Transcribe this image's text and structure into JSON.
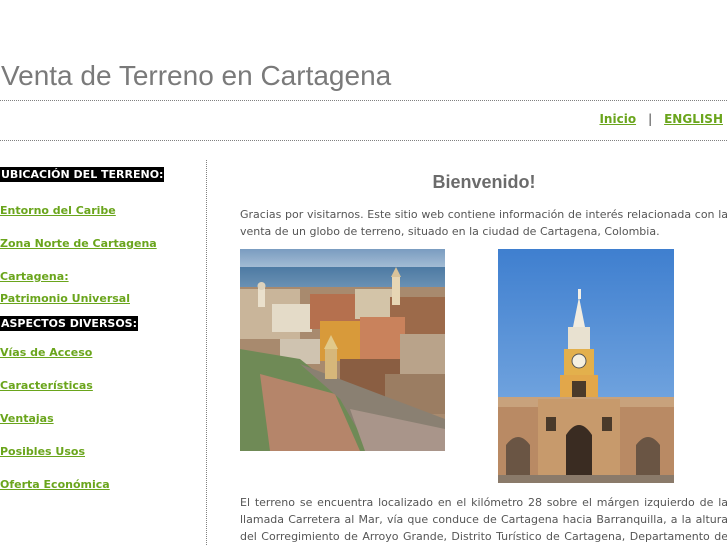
{
  "header": {
    "title": "Venta de Terreno en Cartagena"
  },
  "topnav": {
    "home_label": "Inicio",
    "separator": "|",
    "english_label": "ENGLISH"
  },
  "sidebar": {
    "section1": "UBICACIÓN DEL TERRENO:",
    "section1_items": [
      {
        "label": "Entorno del Caribe"
      },
      {
        "label": "Zona Norte de Cartagena"
      },
      {
        "label": "Cartagena: Patrimonio Universal"
      }
    ],
    "section2": "ASPECTOS DIVERSOS:",
    "section2_items": [
      {
        "label": "Vías de Acceso"
      },
      {
        "label": "Características"
      },
      {
        "label": "Ventajas"
      },
      {
        "label": "Posibles Usos"
      },
      {
        "label": "Oferta Económica"
      }
    ]
  },
  "main": {
    "heading": "Bienvenido!",
    "intro": " Gracias por visitarnos. Este sitio web contiene  información de interés relacionada con la venta de un globo de terreno, situado en la ciudad de Cartagena, Colombia.",
    "body": "El terreno se encuentra localizado en el kilómetro 28 sobre el márgen izquierdo de la llamada Carretera al Mar, vía que conduce de Cartagena  hacia Barranquilla, a la altura del Corregimiento de Arroyo Grande, Distrito Turístico de Cartagena, Departamento de Bolívar,"
  },
  "colors": {
    "link_green": "#6aa51c",
    "title_gray": "#7a7a7a",
    "section_bg": "#000000"
  }
}
